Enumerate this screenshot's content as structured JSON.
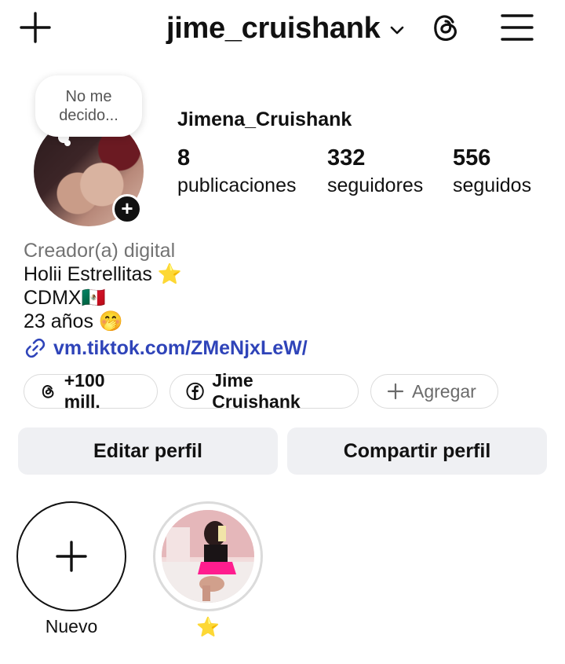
{
  "header": {
    "username": "jime_cruishank"
  },
  "note": {
    "text": "No me decido..."
  },
  "profile": {
    "display_name": "Jimena_Cruishank",
    "stats": [
      {
        "value": "8",
        "label": "publicaciones"
      },
      {
        "value": "332",
        "label": "seguidores"
      },
      {
        "value": "556",
        "label": "seguidos"
      }
    ],
    "category": "Creador(a) digital",
    "bio_lines": [
      "Holii Estrellitas ⭐",
      "CDMX🇲🇽",
      "23 años 🤭"
    ],
    "link": "vm.tiktok.com/ZMeNjxLeW/"
  },
  "chips": [
    {
      "icon": "threads-icon",
      "label": "+100 mill."
    },
    {
      "icon": "facebook-icon",
      "label": "Jime Cruishank"
    },
    {
      "icon": "plus-icon",
      "label": "Agregar"
    }
  ],
  "actions": {
    "edit": "Editar perfil",
    "share": "Compartir perfil"
  },
  "highlights": [
    {
      "label": "Nuevo"
    },
    {
      "label": "⭐"
    }
  ]
}
